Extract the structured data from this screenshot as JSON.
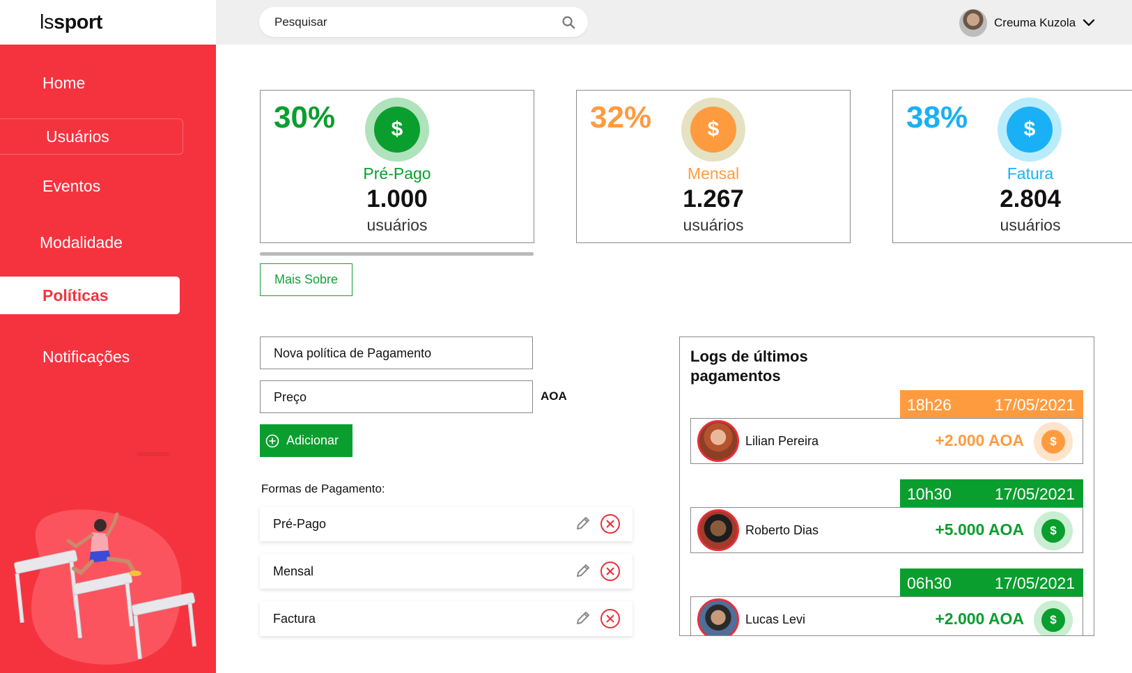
{
  "app": {
    "logo_prefix": "ls",
    "logo_suffix": "sport"
  },
  "search": {
    "placeholder": "Pesquisar"
  },
  "user": {
    "name": "Creuma Kuzola"
  },
  "sidebar": {
    "items": [
      {
        "label": "Home"
      },
      {
        "label": "Usuários"
      },
      {
        "label": "Eventos"
      },
      {
        "label": "Modalidade"
      },
      {
        "label": "Políticas"
      },
      {
        "label": "Notificações"
      }
    ]
  },
  "stats": [
    {
      "percent": "30%",
      "type": "Pré-Pago",
      "count": "1.000",
      "unit": "usuários",
      "color": "#0a9e2f",
      "ring": "#aee3bb",
      "icon": "dollar-icon"
    },
    {
      "percent": "32%",
      "type": "Mensal",
      "count": "1.267",
      "unit": "usuários",
      "color": "#ff9b3f",
      "ring": "#e4e2c2",
      "icon": "dollar-icon"
    },
    {
      "percent": "38%",
      "type": "Fatura",
      "count": "2.804",
      "unit": "usuários",
      "color": "#1ab0f5",
      "ring": "#b9ecfb",
      "icon": "dollar-icon"
    }
  ],
  "more_button": "Mais Sobre",
  "form": {
    "policy_placeholder": "Nova política de Pagamento",
    "price_placeholder": "Preço",
    "currency": "AOA",
    "add_button": "Adicionar"
  },
  "payment_methods": {
    "title": "Formas de Pagamento:",
    "items": [
      {
        "label": "Pré-Pago"
      },
      {
        "label": "Mensal"
      },
      {
        "label": "Factura"
      }
    ]
  },
  "logs": {
    "title": "Logs de últimos pagamentos",
    "entries": [
      {
        "time": "18h26",
        "date": "17/05/2021",
        "name": "Lilian Pereira",
        "amount": "+2.000 AOA",
        "color": "#ff9b3f",
        "coin": "#ffe3cb"
      },
      {
        "time": "10h30",
        "date": "17/05/2021",
        "name": "Roberto Dias",
        "amount": "+5.000 AOA",
        "color": "#0a9e2f",
        "coin": "#c9eed1"
      },
      {
        "time": "06h30",
        "date": "17/05/2021",
        "name": "Lucas Levi",
        "amount": "+2.000 AOA",
        "color": "#0a9e2f",
        "coin": "#c9eed1"
      }
    ]
  }
}
